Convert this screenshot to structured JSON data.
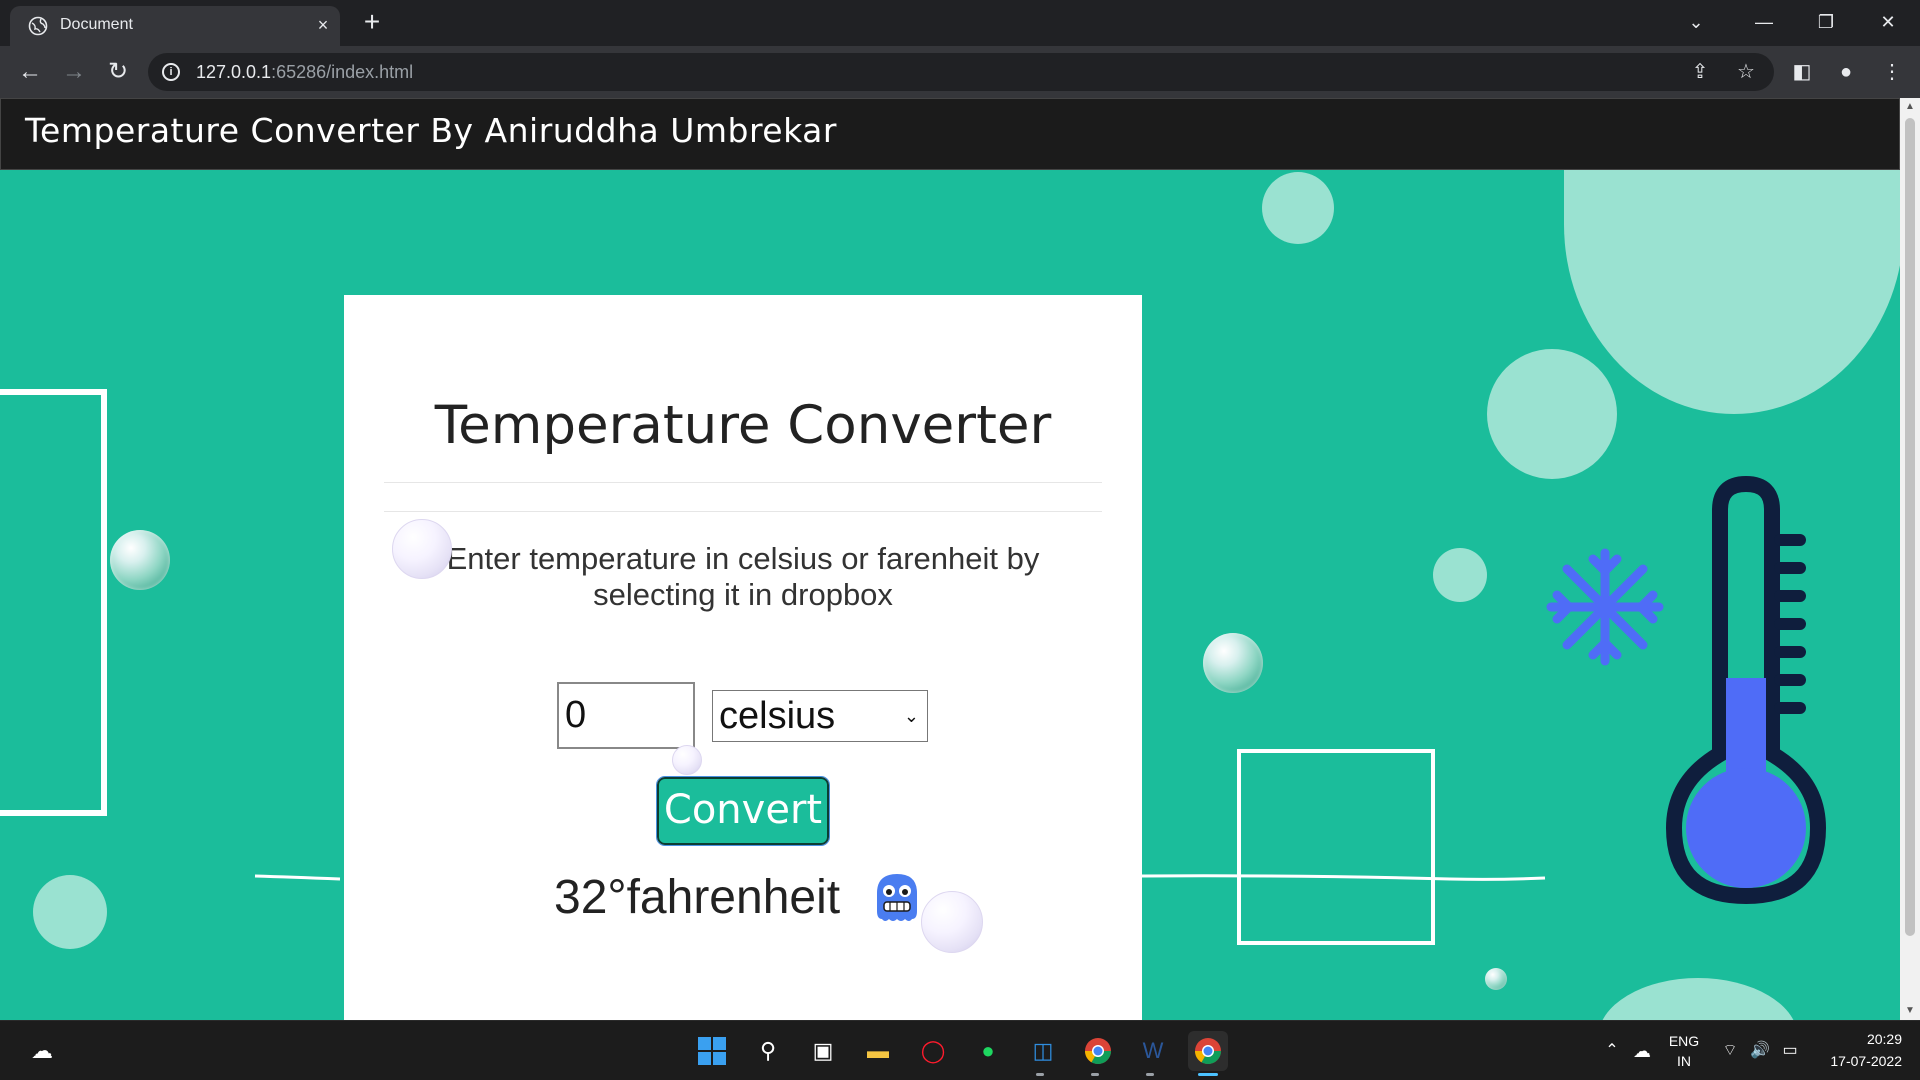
{
  "browser": {
    "tab_title": "Document",
    "tab_close": "×",
    "new_tab": "+",
    "url_host": "127.0.0.1",
    "url_rest": ":65286/index.html",
    "icons": [
      "back-arrow-icon",
      "forward-arrow-icon",
      "reload-icon",
      "share-icon",
      "star-icon",
      "side-panel-icon",
      "profile-icon",
      "menu-icon"
    ]
  },
  "header": {
    "title": "Temperature Converter By Aniruddha Umbrekar"
  },
  "card": {
    "title": "Temperature Converter",
    "description": "Enter temperature in celsius or farenheit by selecting it in dropbox",
    "input_value": "0",
    "select_value": "celsius",
    "button_label": "Convert",
    "result": "32°fahrenheit"
  },
  "taskbar": {
    "language": "ENG",
    "region": "IN",
    "time": "20:29",
    "date": "17-07-2022"
  },
  "colors": {
    "page_bg": "#1bbd9b",
    "header_bg": "#1b1b1b",
    "thermometer_fill": "#4f6cf7",
    "thermometer_outline": "#0f1e3d"
  }
}
